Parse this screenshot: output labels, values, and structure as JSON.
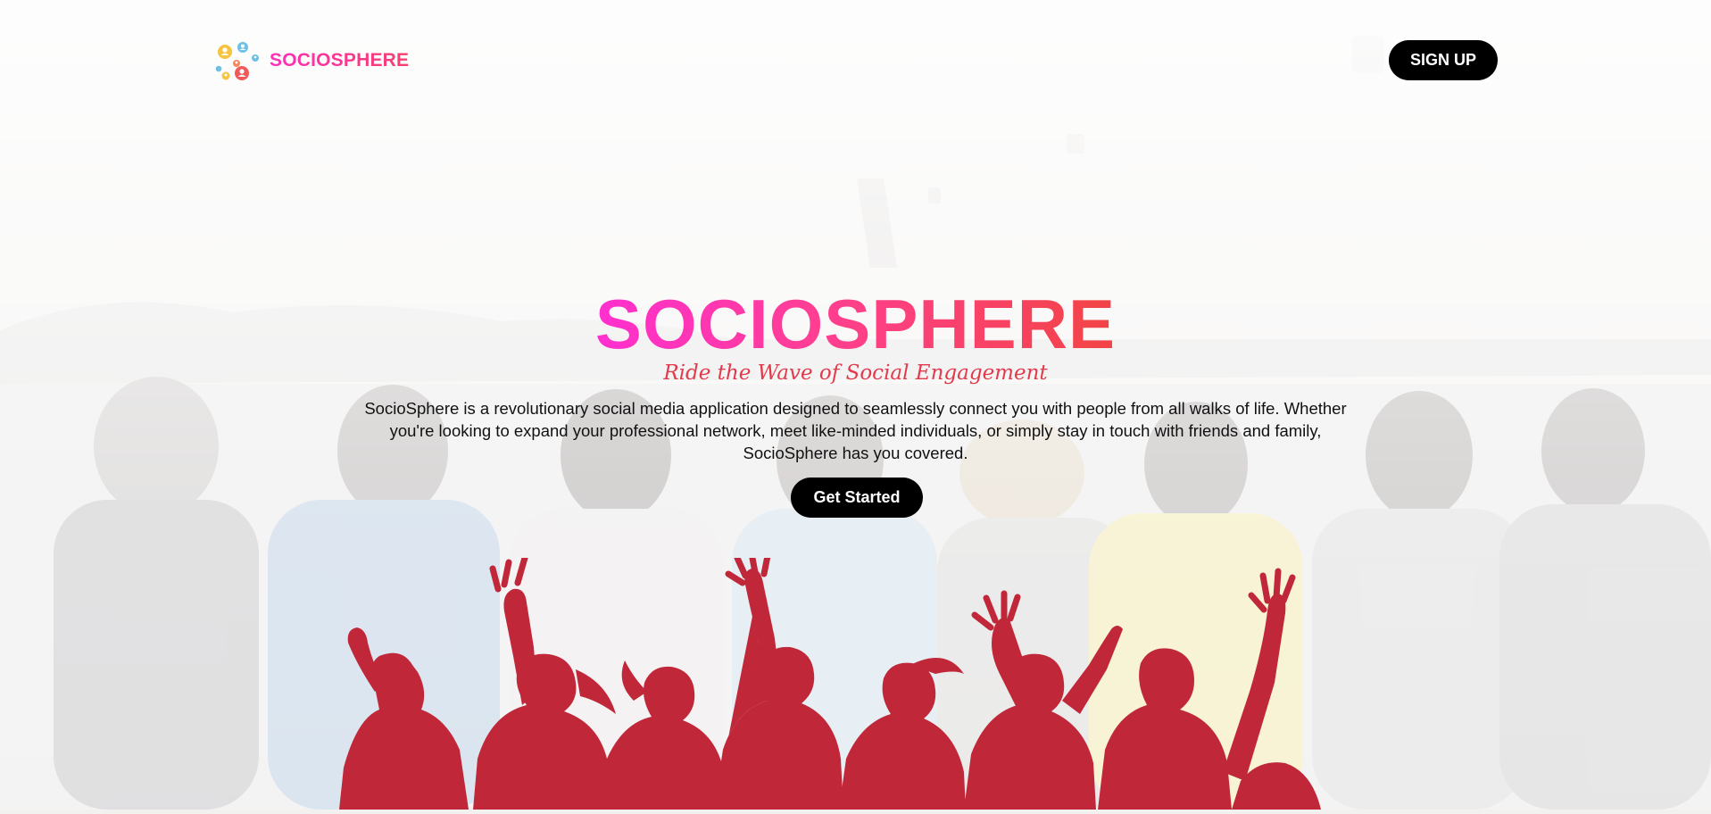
{
  "brand": {
    "logo_icon": "people-network-icon",
    "name": "SOCIOSPHERE",
    "gradient_start": "#ff2fb8",
    "gradient_end": "#f43f6e"
  },
  "header": {
    "signup_label": "SIGN UP"
  },
  "hero": {
    "title": "SOCIOSPHERE",
    "tagline": "Ride the Wave of Social Engagement",
    "description": "SocioSphere is a revolutionary social media application designed to seamlessly connect you with people from all walks of life. Whether you're looking to expand your professional network, meet like-minded individuals, or simply stay in touch with friends and family, SocioSphere has you covered.",
    "cta_label": "Get Started",
    "title_gradient": [
      "#ff2fd0",
      "#ff3f8f",
      "#f24444"
    ],
    "silhouette_color": "#c0283a",
    "background_image": "group-of-friends-hugging-photo"
  }
}
